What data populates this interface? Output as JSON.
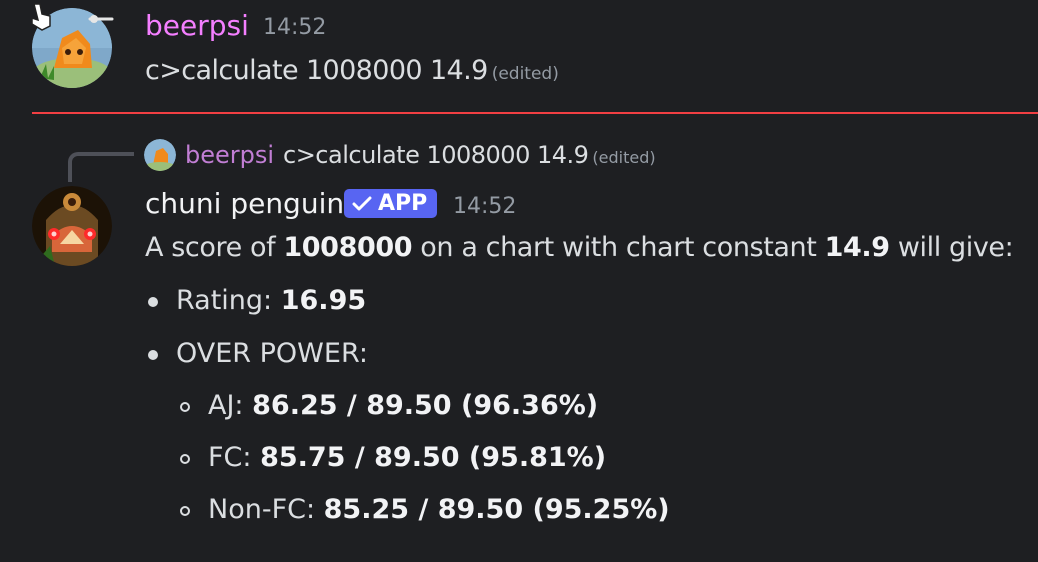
{
  "message1": {
    "username": "beerpsi",
    "timestamp": "14:52",
    "text": "c>calculate 1008000 14.9",
    "edited_label": "(edited)"
  },
  "reply": {
    "username": "beerpsi",
    "text": "c>calculate 1008000 14.9",
    "edited_label": "(edited)"
  },
  "message2": {
    "username": "chuni penguin",
    "badge": "APP",
    "timestamp": "14:52",
    "intro": {
      "prefix": "A score of ",
      "score": "1008000",
      "middle": " on a chart with chart constant ",
      "constant": "14.9",
      "suffix": " will give:"
    },
    "rating": {
      "label": "Rating: ",
      "value": "16.95"
    },
    "over_power_label": "OVER POWER:",
    "over_power": [
      {
        "label": "AJ: ",
        "value": "86.25 / 89.50 (96.36%)"
      },
      {
        "label": "FC: ",
        "value": "85.75 / 89.50 (95.81%)"
      },
      {
        "label": "Non-FC: ",
        "value": "85.25 / 89.50 (95.25%)"
      }
    ]
  },
  "colors": {
    "background": "#1e1f22",
    "user1_name": "#f47fff",
    "reply_name": "#c17ed4",
    "app_badge": "#5865f2",
    "divider": "#f23f43"
  }
}
